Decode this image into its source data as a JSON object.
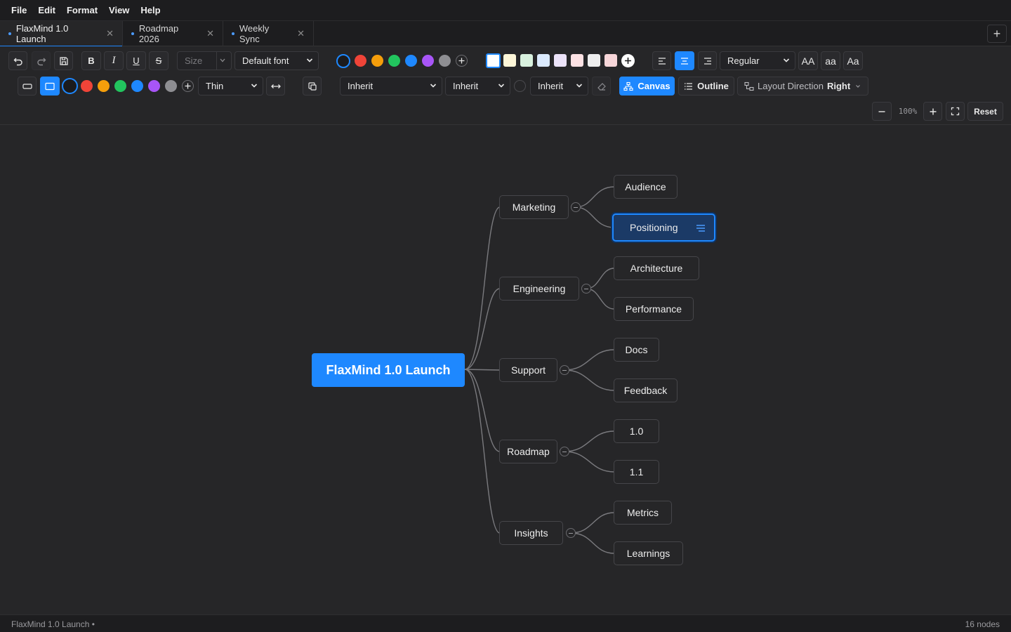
{
  "menu": [
    "File",
    "Edit",
    "Format",
    "View",
    "Help"
  ],
  "tabs": [
    {
      "label": "FlaxMind 1.0 Launch",
      "active": true
    },
    {
      "label": "Roadmap 2026",
      "active": false
    },
    {
      "label": "Weekly Sync",
      "active": false
    }
  ],
  "tab_add_label": "+",
  "toolbar": {
    "bold": "B",
    "italic": "I",
    "underline": "U",
    "strike": "S",
    "size_placeholder": "Size",
    "font": "Default font",
    "text_colors": [
      "#2b2b2e",
      "#f04438",
      "#f59e0b",
      "#22c55e",
      "#1e88ff",
      "#a855f7",
      "#8e8e92"
    ],
    "fill_colors": [
      "#ffffff",
      "#fdf6d8",
      "#d9f1df",
      "#dbeafe",
      "#ece3f9",
      "#fde2e4",
      "#eeeeee",
      "#f7d6d9"
    ],
    "weight": "Regular",
    "case_upper": "AA",
    "case_lower": "aa",
    "case_title": "Aa",
    "border_colors": [
      "#2b2b2e",
      "#f04438",
      "#f59e0b",
      "#22c55e",
      "#1e88ff",
      "#a855f7",
      "#8e8e92"
    ],
    "line_width": "Thin",
    "line_style": "Inherit",
    "line_end": "Inherit",
    "line_color": "Inherit",
    "view_canvas": "Canvas",
    "view_outline": "Outline",
    "layout_label": "Layout Direction",
    "layout_value": "Right",
    "zoom": "100%",
    "reset": "Reset"
  },
  "mindmap": {
    "root": "FlaxMind 1.0 Launch",
    "branches": [
      {
        "label": "Marketing",
        "children": [
          "Audience",
          "Positioning"
        ]
      },
      {
        "label": "Engineering",
        "children": [
          "Architecture",
          "Performance"
        ]
      },
      {
        "label": "Support",
        "children": [
          "Docs",
          "Feedback"
        ]
      },
      {
        "label": "Roadmap",
        "children": [
          "1.0",
          "1.1"
        ]
      },
      {
        "label": "Insights",
        "children": [
          "Metrics",
          "Learnings"
        ]
      }
    ],
    "selected": "Positioning"
  },
  "status": {
    "document": "FlaxMind 1.0 Launch •",
    "count": "16 nodes"
  }
}
